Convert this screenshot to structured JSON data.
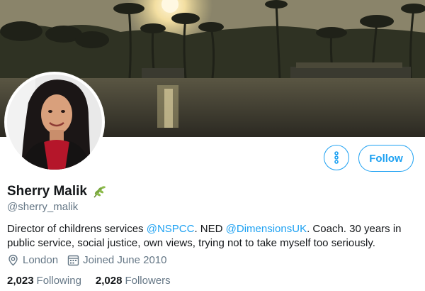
{
  "header": {
    "banner": "sunset-palms-backwater-image",
    "more_button_icon": "more-vertical-icon",
    "follow_label": "Follow"
  },
  "profile": {
    "name": "Sherry Malik",
    "name_emoji_icon": "leaf-icon",
    "handle": "@sherry_malik",
    "bio": {
      "p1": "Director of childrens services ",
      "mention1": "@NSPCC",
      "p2": ". NED ",
      "mention2": "@DimensionsUK",
      "p3": ". Coach. 30 years in public service, social justice, own views, trying not to take myself too seriously."
    },
    "location": "London",
    "joined": "Joined June 2010",
    "following_count": "2,023",
    "following_label": "Following",
    "followers_count": "2,028",
    "followers_label": "Followers"
  },
  "colors": {
    "accent": "#1da1f2",
    "secondary_text": "#657786",
    "primary_text": "#14171a"
  }
}
